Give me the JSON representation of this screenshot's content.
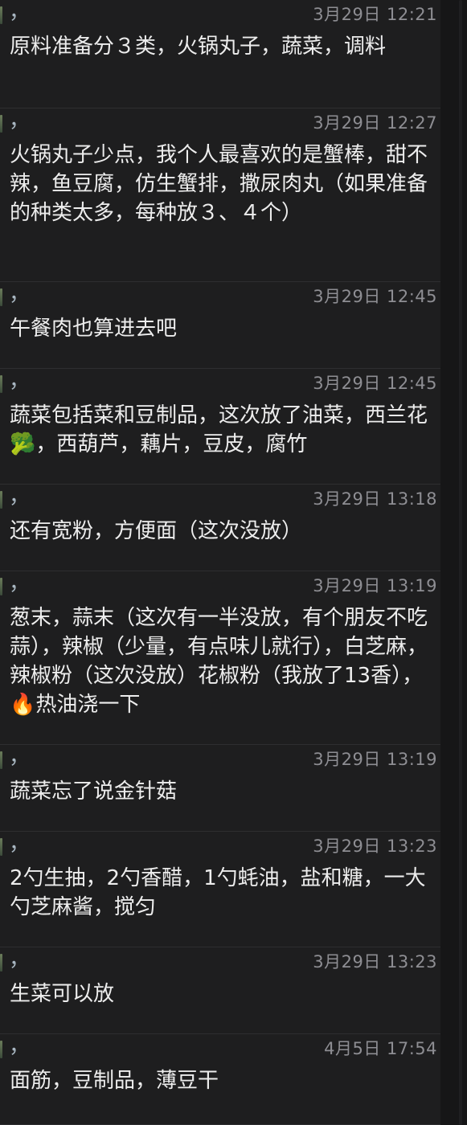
{
  "messages": [
    {
      "sender": "，",
      "time": "3月29日 12:21",
      "text": "原料准备分３类，火锅丸子，蔬菜，调料"
    },
    {
      "sender": "，",
      "time": "3月29日 12:27",
      "text": "火锅丸子少点，我个人最喜欢的是蟹棒，甜不辣，鱼豆腐，仿生蟹排，撒尿肉丸（如果准备的种类太多，每种放３、４个）"
    },
    {
      "sender": "，",
      "time": "3月29日 12:45",
      "text": "午餐肉也算进去吧"
    },
    {
      "sender": "，",
      "time": "3月29日 12:45",
      "text": "蔬菜包括菜和豆制品，这次放了油菜，西兰花🥦，西葫芦，藕片，豆皮，腐竹"
    },
    {
      "sender": "，",
      "time": "3月29日 13:18",
      "text": "还有宽粉，方便面（这次没放）"
    },
    {
      "sender": "，",
      "time": "3月29日 13:19",
      "text": "葱末，蒜末（这次有一半没放，有个朋友不吃蒜），辣椒（少量，有点味儿就行），白芝麻，辣椒粉（这次没放）花椒粉（我放了13香），🔥热油浇一下"
    },
    {
      "sender": "，",
      "time": "3月29日 13:19",
      "text": "蔬菜忘了说金针菇"
    },
    {
      "sender": "，",
      "time": "3月29日 13:23",
      "text": "2勺生抽，2勺香醋，1勺蚝油，盐和糖，一大勺芝麻酱，搅匀"
    },
    {
      "sender": "，",
      "time": "3月29日 13:23",
      "text": "生菜可以放"
    },
    {
      "sender": "，",
      "time": "4月5日 17:54",
      "text": "面筋，豆制品，薄豆干"
    }
  ]
}
